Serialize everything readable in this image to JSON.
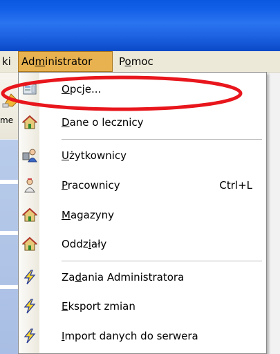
{
  "menubar": {
    "items": [
      {
        "label": "ki",
        "underline_index": -1
      },
      {
        "label": "Administrator",
        "underline_index": 2
      },
      {
        "label": "Pomoc",
        "underline_index": 1
      }
    ]
  },
  "background": {
    "toolbar_text": "me"
  },
  "menu": {
    "items": [
      {
        "label": "Opcje...",
        "underline_index": 0,
        "icon": "options-icon",
        "shortcut": ""
      },
      {
        "label": "Dane o lecznicy",
        "underline_index": 0,
        "icon": "house-icon",
        "shortcut": ""
      },
      {
        "label": "Użytkownicy",
        "underline_index": 0,
        "icon": "users-icon",
        "shortcut": ""
      },
      {
        "label": "Pracownicy",
        "underline_index": 0,
        "icon": "employee-icon",
        "shortcut": "Ctrl+L"
      },
      {
        "label": "Magazyny",
        "underline_index": 0,
        "icon": "house-icon",
        "shortcut": ""
      },
      {
        "label": "Oddziały",
        "underline_index": 4,
        "icon": "house-icon",
        "shortcut": ""
      },
      {
        "label": "Zadania Administratora",
        "underline_index": 2,
        "icon": "lightning-icon",
        "shortcut": ""
      },
      {
        "label": "Eksport zmian",
        "underline_index": 0,
        "icon": "lightning-icon",
        "shortcut": ""
      },
      {
        "label": "Import danych do serwera",
        "underline_index": 0,
        "icon": "lightning-icon",
        "shortcut": ""
      }
    ]
  },
  "colors": {
    "titlebar": "#1e63e2",
    "menubar": "#ece9d8",
    "active_menu": "#e8b250",
    "annotation": "#e8161c"
  }
}
